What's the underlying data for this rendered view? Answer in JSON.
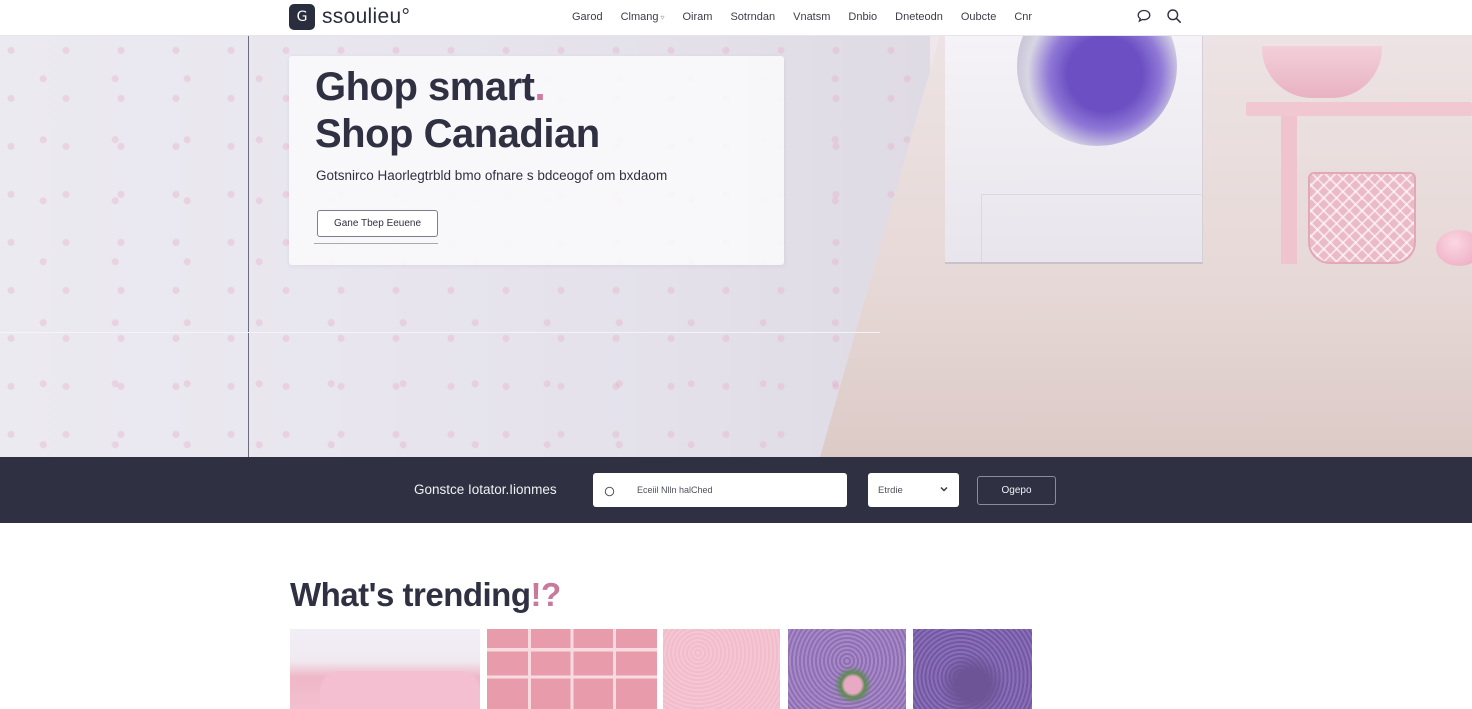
{
  "header": {
    "logo_mark": "G",
    "logo_text": "ssoulieu°",
    "nav": [
      {
        "label": "Garod",
        "has_chevron": false
      },
      {
        "label": "Clmang",
        "has_chevron": true
      },
      {
        "label": "Oiram",
        "has_chevron": false
      },
      {
        "label": "Sotrndan",
        "has_chevron": false
      },
      {
        "label": "Vnatsm",
        "has_chevron": false
      },
      {
        "label": "Dnbio",
        "has_chevron": false
      },
      {
        "label": "Dneteodn",
        "has_chevron": false
      },
      {
        "label": "Oubcte",
        "has_chevron": false
      },
      {
        "label": "Cnr",
        "has_chevron": false
      }
    ],
    "chevron_glyph": "▿",
    "icons": [
      "chat-bubble-icon",
      "search-icon"
    ]
  },
  "hero": {
    "title_line1": "Ghop smart",
    "title_dot": ".",
    "title_line2": "Shop Canadian",
    "subtitle": "Gotsnirco Haorlegtrbld bmo ofnare s bdceogof om bxdaom",
    "button_label": "Gane Tbep Eeuene"
  },
  "search_band": {
    "label": "Gonstce Iotator.Iionmes",
    "search_placeholder": "Eceiil Nlln halChed",
    "select_value": "Etrdie",
    "button_label": "Ogepo"
  },
  "trending": {
    "title": "What's trending",
    "title_suffix": "!?",
    "tiles": [
      {
        "name": "pink-bedroom"
      },
      {
        "name": "pink-bookshelf"
      },
      {
        "name": "pink-rug"
      },
      {
        "name": "lavender-flowers"
      },
      {
        "name": "purple-lavender-field"
      }
    ]
  },
  "colors": {
    "brand_dark": "#2f3142",
    "accent_pink": "#d3799f",
    "header_bg": "#ffffff"
  }
}
